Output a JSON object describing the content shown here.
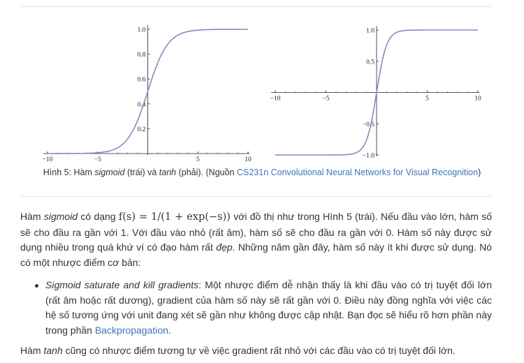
{
  "chart_data": [
    {
      "type": "line",
      "function": "sigmoid",
      "x_ticks": [
        "-10",
        "-5",
        "5",
        "10"
      ],
      "y_ticks": [
        "0.2",
        "0.4",
        "0.6",
        "0.8",
        "1.0"
      ],
      "xlim": [
        -10,
        10
      ],
      "ylim": [
        0,
        1
      ],
      "series": [
        {
          "color": "#8a87c2"
        }
      ]
    },
    {
      "type": "line",
      "function": "tanh",
      "x_ticks": [
        "-10",
        "-5",
        "5",
        "10"
      ],
      "y_ticks": [
        "-1.0",
        "-0.5",
        "0.5",
        "1.0"
      ],
      "xlim": [
        -10,
        10
      ],
      "ylim": [
        -1,
        1
      ],
      "series": [
        {
          "color": "#8a87c2"
        }
      ]
    }
  ],
  "caption": {
    "prefix": "Hình 5: Hàm ",
    "sigmoid": "sigmoid",
    "mid1": " (trái) và ",
    "tanh": "tanh",
    "mid2": " (phải). (Nguồn ",
    "link": "CS231n Convolutional Neural Networks for Visual Recognition",
    "suffix": ")"
  },
  "para1": {
    "t1": "Hàm ",
    "sigmoid": "sigmoid",
    "t2": " có dạng ",
    "formula": "f(s) = 1/(1 + exp(−s))",
    "t3": " với đồ thị như trong Hình 5 (trái). Nếu đầu vào lớn, hàm số sẽ cho đầu ra gần với 1. Với đầu vào nhỏ (rất âm), hàm số sẽ cho đầu ra gần với 0. Hàm số này được sử dụng nhiều trong quá khứ ví có đạo hàm rất ",
    "dep": "đẹp",
    "t4": ". Những năm gần đây, hàm số này ít khi được sử dụng. Nó có một nhược điểm cơ bản:"
  },
  "bullet": {
    "title": "Sigmoid saturate and kill gradients",
    "t1": ": Một nhược điểm dễ nhận thấy là khi đầu vào có trị tuyệt đối lớn (rất âm hoặc rất dương), gradient của hàm số này sẽ rất gần với 0. Điều này đồng nghĩa với việc các hệ số tương ứng với unit đang xét sẽ gần như không được cập nhật. Bạn đọc sẽ hiểu rõ hơn phần này trong phần ",
    "link": "Backpropagation",
    "t2": "."
  },
  "para2": {
    "t1": "Hàm ",
    "tanh": "tanh",
    "t2": " cũng có nhược điểm tương tự về việc gradient rất nhỏ với các đầu vào có trị tuyệt đối lớn."
  }
}
